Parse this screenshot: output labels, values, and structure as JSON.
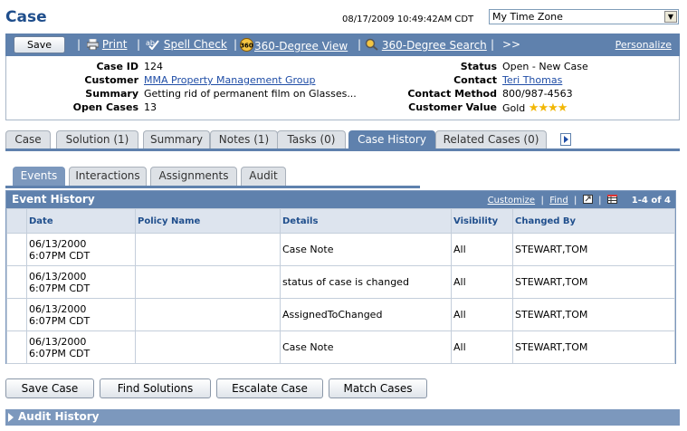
{
  "header": {
    "title": "Case",
    "timestamp": "08/17/2009 10:49:42AM CDT",
    "timezone": "My Time Zone"
  },
  "toolbar": {
    "save_label": "Save",
    "print_label": "Print",
    "spell_label": "Spell Check",
    "view360_label": "360-Degree View",
    "search360_label": "360-Degree Search",
    "more_label": ">>",
    "personalize_label": "Personalize",
    "badge_360": "360"
  },
  "summary": {
    "case_id_label": "Case ID",
    "case_id": "124",
    "customer_label": "Customer",
    "customer": "MMA Property Management Group",
    "summary_label": "Summary",
    "summary": "Getting rid of permanent film on Glasses...",
    "open_cases_label": "Open Cases",
    "open_cases": "13",
    "status_label": "Status",
    "status": "Open - New Case",
    "contact_label": "Contact",
    "contact": "Teri Thomas",
    "contact_method_label": "Contact Method",
    "contact_method": "800/987-4563",
    "customer_value_label": "Customer Value",
    "customer_value": "Gold",
    "customer_value_stars": 4
  },
  "tabs": [
    {
      "label": "Case"
    },
    {
      "label": "Solution (1)"
    },
    {
      "label": "Summary"
    },
    {
      "label": "Notes (1)"
    },
    {
      "label": "Tasks (0)"
    },
    {
      "label": "Case History"
    },
    {
      "label": "Related Cases (0)"
    }
  ],
  "subtabs": [
    {
      "label": "Events"
    },
    {
      "label": "Interactions"
    },
    {
      "label": "Assignments"
    },
    {
      "label": "Audit"
    }
  ],
  "grid": {
    "title": "Event History",
    "customize": "Customize",
    "find": "Find",
    "count": "1-4 of 4",
    "columns": [
      "Date",
      "Policy Name",
      "Details",
      "Visibility",
      "Changed By"
    ],
    "rows": [
      {
        "date1": "06/13/2000",
        "date2": "6:07PM CDT",
        "policy": "",
        "details": "Case Note",
        "visibility": "All",
        "changed_by": "STEWART,TOM"
      },
      {
        "date1": "06/13/2000",
        "date2": "6:07PM CDT",
        "policy": "",
        "details": "status of case is changed",
        "visibility": "All",
        "changed_by": "STEWART,TOM"
      },
      {
        "date1": "06/13/2000",
        "date2": "6:07PM CDT",
        "policy": "",
        "details": "AssignedToChanged",
        "visibility": "All",
        "changed_by": "STEWART,TOM"
      },
      {
        "date1": "06/13/2000",
        "date2": "6:07PM CDT",
        "policy": "",
        "details": "Case Note",
        "visibility": "All",
        "changed_by": "STEWART,TOM"
      }
    ]
  },
  "buttons": {
    "save_case": "Save Case",
    "find_solutions": "Find Solutions",
    "escalate_case": "Escalate Case",
    "match_cases": "Match Cases"
  },
  "audit": {
    "label": "Audit History"
  },
  "colors": {
    "accent": "#5f81ad",
    "title": "#1f4e8c",
    "link": "#1f4da6"
  }
}
